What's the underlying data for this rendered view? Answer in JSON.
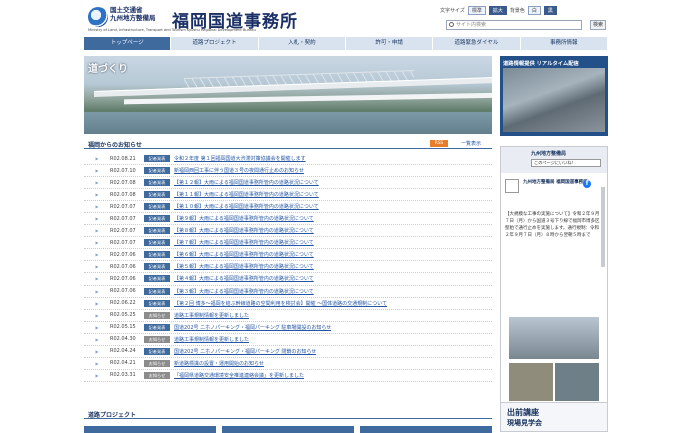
{
  "header": {
    "org_line1": "国土交通省",
    "org_line2": "九州地方整備局",
    "org_en": "Ministry of Land, Infrastructure, Transport and Tourism Kyushu Regional Development Bureau",
    "title": "福岡国道事務所",
    "text_size_label": "文字サイズ",
    "size_std": "標準",
    "size_large": "拡大",
    "color_label": "背景色",
    "color_white": "白",
    "color_black": "黒",
    "search_placeholder": "サイト内検索",
    "search_button": "検索"
  },
  "nav": {
    "items": [
      {
        "label": "トップページ"
      },
      {
        "label": "道路プロジェクト"
      },
      {
        "label": "入札・契約"
      },
      {
        "label": "許可・申請"
      },
      {
        "label": "道路緊急ダイヤル"
      },
      {
        "label": "事務所情報"
      }
    ]
  },
  "hero": {
    "label": "道づくり"
  },
  "news": {
    "title": "福岡からのお知らせ",
    "rss": "RSS",
    "more": "一覧表示",
    "items": [
      {
        "date": "R02.08.21",
        "badge": "記者発表",
        "text": "令和２年度 第１回福岡国道大渋滞対策協議会を開催します"
      },
      {
        "date": "R02.07.10",
        "badge": "記者発表",
        "text": "新福岡西回工事に伴う国道３号の夜間通行止めのお知らせ"
      },
      {
        "date": "R02.07.08",
        "badge": "記者発表",
        "text": "【第１２報】大雨による福岡国道事務所管内の道路状況について"
      },
      {
        "date": "R02.07.08",
        "badge": "記者発表",
        "text": "【第１１報】大雨による福岡国道事務所管内の道路状況について"
      },
      {
        "date": "R02.07.07",
        "badge": "記者発表",
        "text": "【第１０報】大雨による福岡国道事務所管内の道路状況について"
      },
      {
        "date": "R02.07.07",
        "badge": "記者発表",
        "text": "【第９報】大雨による福岡国道事務所管内の道路状況について"
      },
      {
        "date": "R02.07.07",
        "badge": "記者発表",
        "text": "【第８報】大雨による福岡国道事務所管内の道路状況について"
      },
      {
        "date": "R02.07.07",
        "badge": "記者発表",
        "text": "【第７報】大雨による福岡国道事務所管内の道路状況について"
      },
      {
        "date": "R02.07.06",
        "badge": "記者発表",
        "text": "【第６報】大雨による福岡国道事務所管内の道路状況について"
      },
      {
        "date": "R02.07.06",
        "badge": "記者発表",
        "text": "【第５報】大雨による福岡国道事務所管内の道路状況について"
      },
      {
        "date": "R02.07.06",
        "badge": "記者発表",
        "text": "【第４報】大雨による福岡国道事務所管内の道路状況について"
      },
      {
        "date": "R02.07.06",
        "badge": "記者発表",
        "text": "【第３報】大雨による福岡国道事務所管内の道路状況について"
      },
      {
        "date": "R02.06.22",
        "badge": "記者発表",
        "text": "【第２回 博多～福岡を結ぶ幹線道路の空間利用を検討会】開催 ～国体道路の交通規制について"
      },
      {
        "date": "R02.05.25",
        "badge": "お知らせ",
        "text": "道路工事規制情報を更新しました"
      },
      {
        "date": "R02.05.15",
        "badge": "記者発表",
        "text": "国道202号 ニホノパーキング・福岡パーキング 駐車場開設のお知らせ"
      },
      {
        "date": "R02.04.30",
        "badge": "お知らせ",
        "text": "道路工事規制情報を更新しました"
      },
      {
        "date": "R02.04.24",
        "badge": "記者発表",
        "text": "国道202号 ニホノパーキング・福岡パーキング 閉鎖のお知らせ"
      },
      {
        "date": "R02.04.21",
        "badge": "お知らせ",
        "text": "新道路標識の設置・運用開始のお知らせ"
      },
      {
        "date": "R02.03.31",
        "badge": "お知らせ",
        "text": "「福岡県道路交通環境安全推進連絡会議」を更新しました"
      }
    ]
  },
  "projects": {
    "title": "道路プロジェクト"
  },
  "sidebar": {
    "camera_title": "道路情報提供 リアルタイム配信",
    "fb_name": "九州地方整備局",
    "fb_follow": "このページにいいね！",
    "fb_post_name": "九州地方整備局 福岡国道事務所",
    "fb_post_text": "【大規模な工事の実施について】令和２年９月７日（月）から国道３号下り線で福岡市博多区堅粕で通行止めを実施します。通行規制：令和２年９月７日（月）８時から翌朝５時まで",
    "lecture_line1": "出前講座",
    "lecture_line2": "現場見学会"
  }
}
